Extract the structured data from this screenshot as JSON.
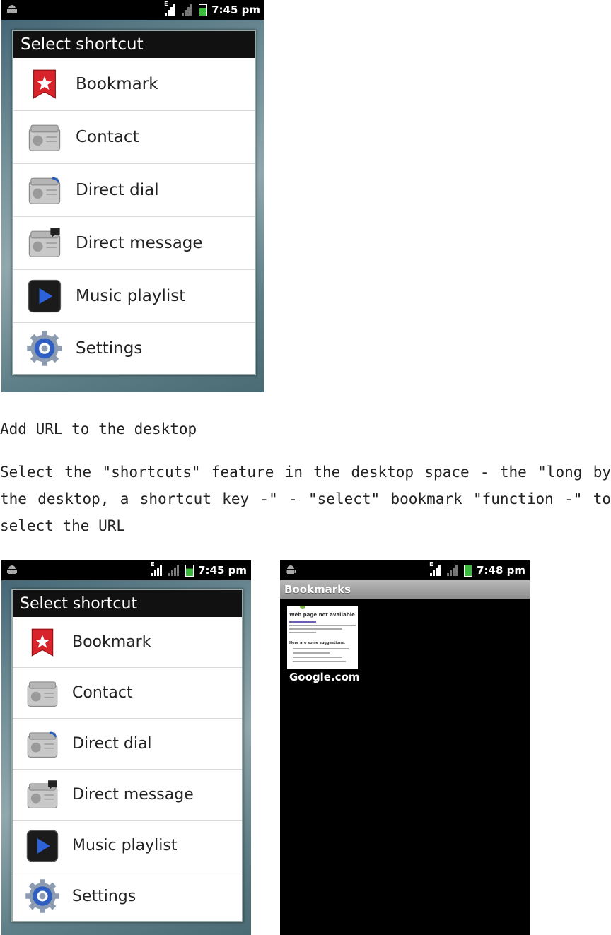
{
  "status_bar": {
    "network_label": "E",
    "time_first": "7:45 pm",
    "time_bookmarks": "7:48 pm"
  },
  "shortcut_dialog": {
    "title": "Select shortcut",
    "items": [
      {
        "label": "Bookmark",
        "icon": "bookmark-icon"
      },
      {
        "label": "Contact",
        "icon": "contact-icon"
      },
      {
        "label": "Direct dial",
        "icon": "direct-dial-icon"
      },
      {
        "label": "Direct message",
        "icon": "direct-message-icon"
      },
      {
        "label": "Music playlist",
        "icon": "music-playlist-icon"
      },
      {
        "label": "Settings",
        "icon": "settings-icon"
      }
    ]
  },
  "text": {
    "heading": "Add URL to the desktop",
    "paragraph": "Select the \"shortcuts\" feature in the desktop space - the \"long by the desktop, a shortcut key -\" - \"select\" bookmark \"function -\" to select the URL"
  },
  "bookmarks_screen": {
    "title": "Bookmarks",
    "thumbnail_title": "Web page not available",
    "thumbnail_subtitle": "Here are some suggestions:",
    "bookmark_label": "Google.com"
  },
  "colors": {
    "bookmark_red": "#d8232a",
    "settings_blue": "#2f5fc2",
    "play_blue": "#2d62d8",
    "battery_green": "#3cb93c"
  }
}
